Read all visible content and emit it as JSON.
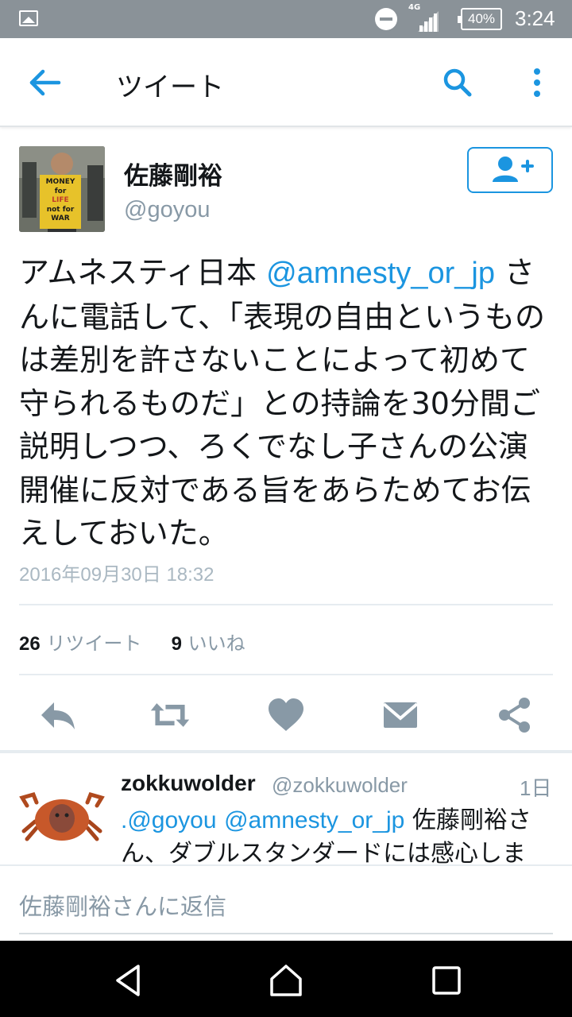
{
  "status_bar": {
    "network": "4G",
    "battery": "40%",
    "time": "3:24"
  },
  "app_bar": {
    "title": "ツイート"
  },
  "tweet": {
    "author_name": "佐藤剛裕",
    "author_handle": "@goyou",
    "avatar_sign_lines": [
      "MONEY",
      "for",
      "LIFE",
      "not for",
      "WAR"
    ],
    "text_before": "アムネスティ日本 ",
    "mention": "@amnesty_or_jp",
    "text_after": " さんに電話して、「表現の自由というものは差別を許さないことによって初めて守られるものだ」との持論を30分間ご説明しつつ、ろくでなし子さんの公演開催に反対である旨をあらためてお伝えしておいた。",
    "timestamp": "2016年09月30日 18:32",
    "retweet_count": "26",
    "retweet_label": "リツイート",
    "like_count": "9",
    "like_label": "いいね"
  },
  "reply": {
    "name": "zokkuwolder",
    "handle": "@zokkuwolder",
    "time": "1日",
    "prefix": ".",
    "mention1": "@goyou",
    "mention2": "@amnesty_or_jp",
    "text": " 佐藤剛裕さん、ダブルスタンダードには感心しま"
  },
  "compose": {
    "placeholder": "佐藤剛裕さんに返信"
  },
  "colors": {
    "accent": "#1b95e0",
    "icon_gray": "#8899a6",
    "status_bar": "#8a9298"
  },
  "icons": [
    "image-icon",
    "do-not-disturb-icon",
    "signal-icon",
    "battery-icon",
    "back-arrow-icon",
    "search-icon",
    "more-vert-icon",
    "follow-icon",
    "reply-icon",
    "retweet-icon",
    "heart-icon",
    "message-icon",
    "share-icon",
    "nav-back-icon",
    "nav-home-icon",
    "nav-recents-icon"
  ]
}
